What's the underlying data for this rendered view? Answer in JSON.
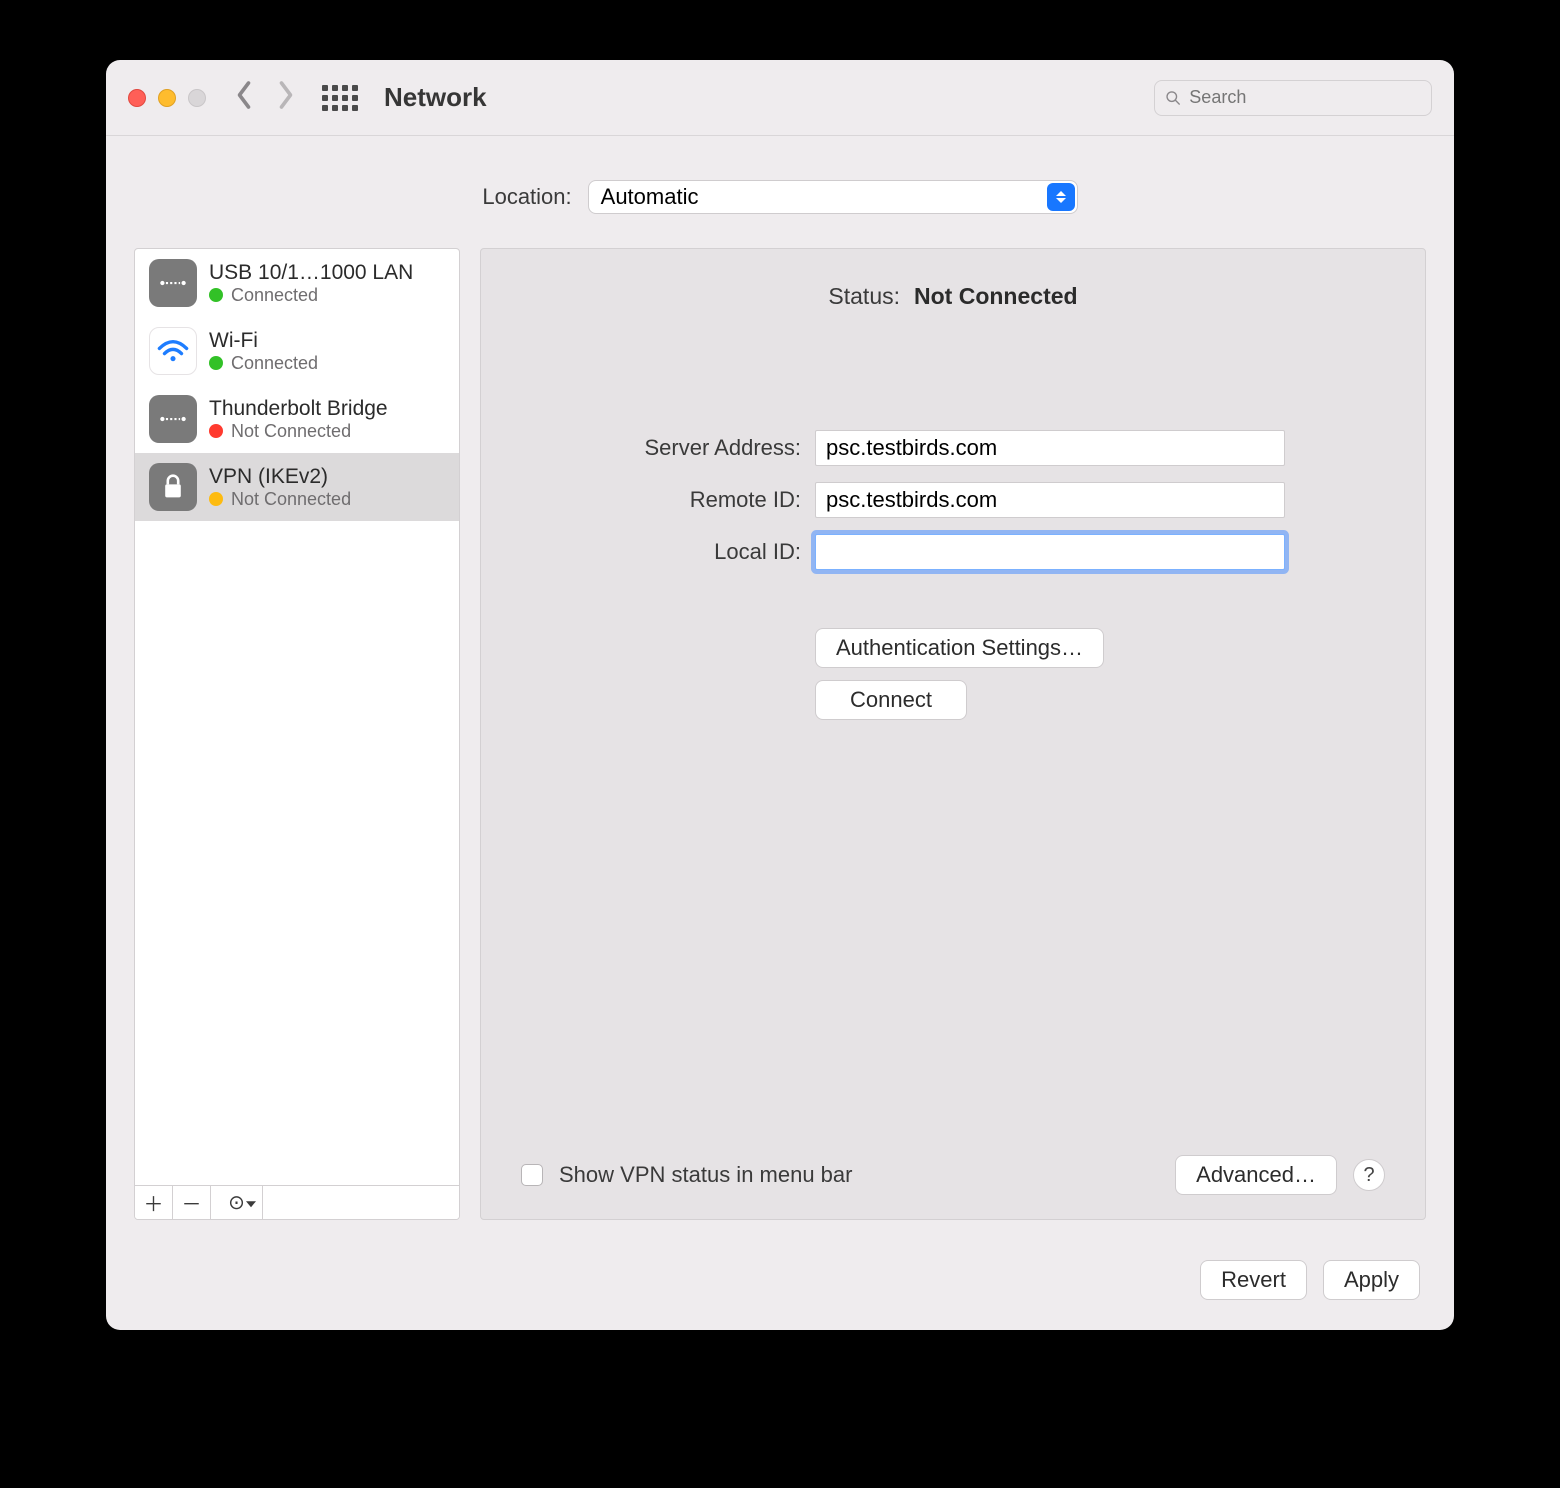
{
  "window": {
    "title": "Network",
    "search_placeholder": "Search"
  },
  "location": {
    "label": "Location:",
    "value": "Automatic"
  },
  "status": {
    "label": "Status:",
    "value": "Not Connected"
  },
  "services": [
    {
      "name": "USB 10/1…1000 LAN",
      "status": "Connected",
      "dot": "green",
      "icon": "eth"
    },
    {
      "name": "Wi-Fi",
      "status": "Connected",
      "dot": "green",
      "icon": "wifi"
    },
    {
      "name": "Thunderbolt Bridge",
      "status": "Not Connected",
      "dot": "red",
      "icon": "eth"
    },
    {
      "name": "VPN (IKEv2)",
      "status": "Not Connected",
      "dot": "amber",
      "icon": "lock"
    }
  ],
  "selected_service_index": 3,
  "sidebar_buttons": {
    "add": "＋",
    "remove": "－",
    "gear": "⊙"
  },
  "form": {
    "server_address": {
      "label": "Server Address:",
      "value": "psc.testbirds.com"
    },
    "remote_id": {
      "label": "Remote ID:",
      "value": "psc.testbirds.com"
    },
    "local_id": {
      "label": "Local ID:",
      "value": ""
    }
  },
  "buttons": {
    "auth_settings": "Authentication Settings…",
    "connect": "Connect",
    "advanced": "Advanced…",
    "help": "?",
    "revert": "Revert",
    "apply": "Apply"
  },
  "checkbox": {
    "show_vpn_label": "Show VPN status in menu bar",
    "checked": false
  }
}
